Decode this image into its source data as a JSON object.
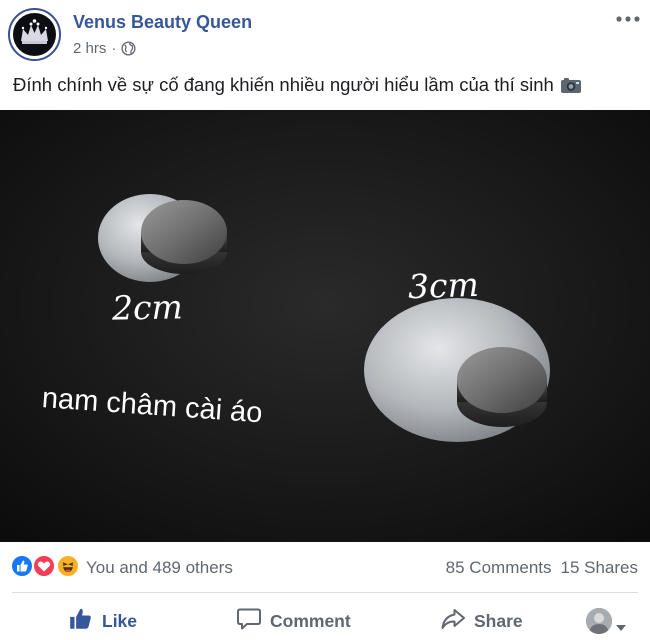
{
  "post": {
    "page_name": "Venus Beauty Queen",
    "time": "2 hrs",
    "separator": "·",
    "text": "Đính chính về sự cố đang khiến nhiều người hiểu lầm của thí sinh",
    "text_icon": "camera-icon",
    "header_icons": [
      "globe-icon",
      "more-options-icon"
    ]
  },
  "photo": {
    "label_small": "2cm",
    "label_large": "3cm",
    "caption": "nam châm cài áo"
  },
  "reactions": {
    "types": [
      "like",
      "love",
      "haha"
    ],
    "colors": {
      "like": "#1877f2",
      "love": "#f33e58",
      "haha": "#f7b125"
    },
    "summary": "You and 489 others",
    "comments": "85 Comments",
    "shares": "15 Shares"
  },
  "actions": {
    "like": "Like",
    "comment": "Comment",
    "share": "Share",
    "icons": [
      "like-icon",
      "comment-icon",
      "share-icon",
      "chevron-down-icon"
    ]
  },
  "theme": {
    "link_color": "#365899",
    "muted_color": "#606770",
    "divider_color": "#dadde1"
  }
}
